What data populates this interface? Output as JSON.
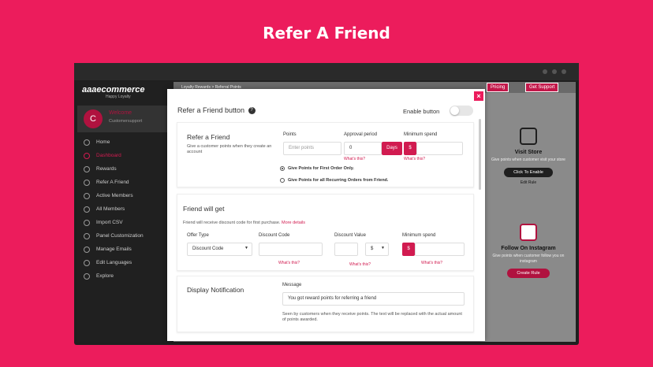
{
  "hero_title": "Refer A Friend",
  "sidebar": {
    "logo": "aaaecommerce",
    "logo_sub": "Happy Loyalty",
    "avatar_letter": "C",
    "profile_name": "Welcome",
    "profile_sub": "Customersupport",
    "items": [
      {
        "label": "Home"
      },
      {
        "label": "Dashboard"
      },
      {
        "label": "Rewards"
      },
      {
        "label": "Refer A Friend"
      },
      {
        "label": "Active Members"
      },
      {
        "label": "All Members"
      },
      {
        "label": "Import CSV"
      },
      {
        "label": "Panel Customization"
      },
      {
        "label": "Manage Emails"
      },
      {
        "label": "Edit Languages"
      },
      {
        "label": "Explore"
      }
    ]
  },
  "topbar": {
    "breadcrumb": "Loyalty Rewards > Referral Points",
    "pricing": "Pricing",
    "support": "Get Support"
  },
  "cards": {
    "visit": {
      "title": "Visit Store",
      "desc": "Give points when customer visit your store",
      "button": "Click To Enable",
      "edit": "Edit Rule"
    },
    "instagram": {
      "title": "Follow On Instagram",
      "desc": "Give points when customer follow you on instagram",
      "button": "Create Rule"
    }
  },
  "modal": {
    "title": "Refer a Friend button",
    "help": "?",
    "close": "×",
    "enable_label": "Enable button",
    "enable_state": "off",
    "refer": {
      "heading": "Refer a Friend",
      "desc": "Give a customer points when they create an account",
      "points_label": "Points",
      "points_placeholder": "Enter points",
      "approval_label": "Approval period",
      "approval_value": "0",
      "days": "Days",
      "minspend_label": "Minimum spend",
      "currency": "$",
      "whats_this": "What's this?",
      "radio1": "Give Points for First Order Only.",
      "radio2": "Give Points for all Recurring Orders from Friend."
    },
    "friend": {
      "heading": "Friend will get",
      "desc": "Friend will receive discount code for first purchase.",
      "more": "More details",
      "offer_label": "Offer Type",
      "offer_value": "Discount Code",
      "code_label": "Discount Code",
      "value_label": "Discount Value",
      "value_unit": "$",
      "minspend_label": "Minimum spend",
      "currency": "$",
      "whats_this": "What's this?"
    },
    "notify": {
      "heading": "Display Notification",
      "message_label": "Message",
      "message_value": "You got  reward points for referring a friend",
      "help": "Seen by customers when they receive points. The text will be replaced with the actual amount of points awarded."
    }
  }
}
